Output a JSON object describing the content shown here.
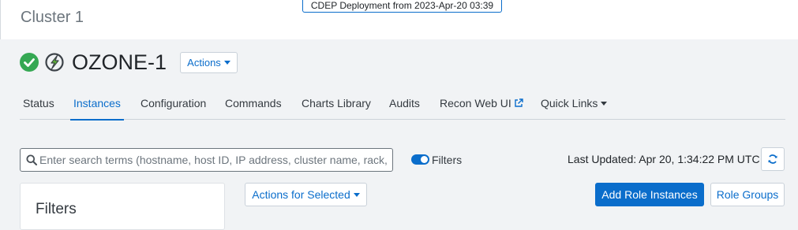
{
  "cluster": {
    "title": "Cluster 1"
  },
  "banner": {
    "text": "CDEP Deployment from 2023-Apr-20 03:39"
  },
  "service": {
    "name": "OZONE-1",
    "status_icon": "check-circle-icon",
    "service_icon": "ozone-icon",
    "actions_label": "Actions"
  },
  "tabs": [
    {
      "label": "Status"
    },
    {
      "label": "Instances"
    },
    {
      "label": "Configuration"
    },
    {
      "label": "Commands"
    },
    {
      "label": "Charts Library"
    },
    {
      "label": "Audits"
    },
    {
      "label": "Recon Web UI"
    },
    {
      "label": "Quick Links"
    }
  ],
  "active_tab": "Instances",
  "search": {
    "value": "",
    "placeholder": "Enter search terms (hostname, host ID, IP address, cluster name, rack,"
  },
  "filters_toggle": {
    "label": "Filters",
    "on": true
  },
  "last_updated": {
    "text": "Last Updated: Apr 20, 1:34:22 PM UTC"
  },
  "filters_panel": {
    "heading": "Filters"
  },
  "toolbar": {
    "actions_selected_label": "Actions for Selected",
    "add_role_label": "Add Role Instances",
    "role_groups_label": "Role Groups"
  },
  "colors": {
    "accent": "#0a6dcb",
    "success": "#35a853",
    "page_bg": "#f1f3f5"
  }
}
